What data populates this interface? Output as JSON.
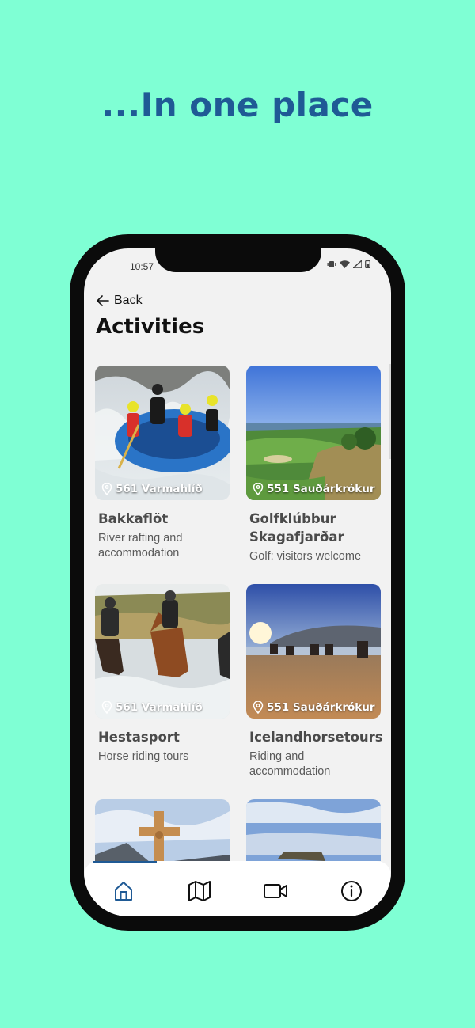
{
  "headline": "...In one place",
  "status": {
    "time": "10:57"
  },
  "nav": {
    "back_label": "Back"
  },
  "page_title": "Activities",
  "cards": [
    {
      "name": "Bakkaflöt",
      "description": "River rafting and accommodation",
      "location": "561 Varmahlíð",
      "image": "river-rafting-photo"
    },
    {
      "name": "Golfklúbbur Skagafjarðar",
      "description": "Golf: visitors welcome",
      "location": "551 Sauðárkrókur",
      "image": "golf-course-photo"
    },
    {
      "name": "Hestasport",
      "description": "Horse riding tours",
      "location": "561 Varmahlíð",
      "image": "horse-river-photo"
    },
    {
      "name": "Icelandhorsetours",
      "description": "Riding and accommodation",
      "location": "551 Sauðárkrókur",
      "image": "beach-horses-photo"
    },
    {
      "image": "cross-statue-photo"
    },
    {
      "image": "coastline-photo"
    }
  ],
  "tabs": [
    {
      "icon": "home-icon",
      "active": true
    },
    {
      "icon": "map-icon",
      "active": false
    },
    {
      "icon": "video-icon",
      "active": false
    },
    {
      "icon": "info-icon",
      "active": false
    }
  ],
  "colors": {
    "background": "#7fffd4",
    "accent": "#1f5a95",
    "screen": "#f2f2f2"
  }
}
